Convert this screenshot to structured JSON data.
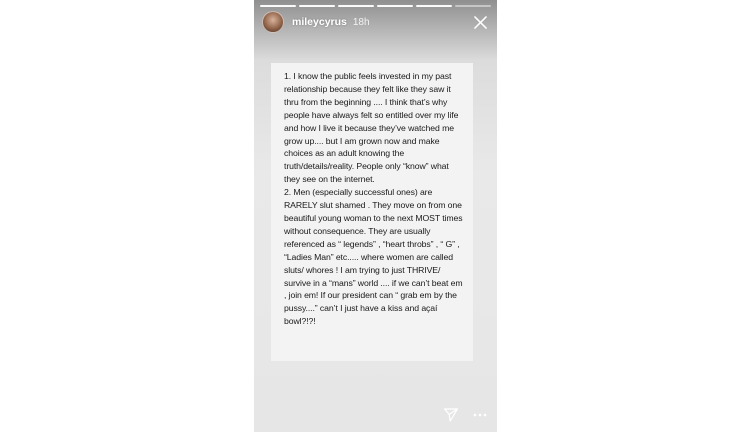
{
  "story": {
    "progress_segments": 6,
    "progress_done": 5,
    "user": {
      "username": "mileycyrus",
      "time": "18h"
    },
    "text": "1. I know the public feels invested in my past relationship because they felt like they saw it thru from the beginning .... I think that’s why people have always felt so entitled over my life and how I live it because they’ve watched me grow up.... but I am grown now and make choices as an adult knowing the truth/details/reality. People only “know” what they see on the internet.\n2. Men (especially successful ones) are RARELY slut shamed . They move on from one beautiful young woman to the next MOST times without consequence. They are usually referenced as “ legends” , “heart throbs” , “ G” , “Ladies Man” etc..... where women are called sluts/ whores ! I am trying to just THRIVE/ survive in a “mans” world .... if we can’t beat em , join em! If our president can “ grab em by the pussy....”  can’t I just have a kiss and açaí bowl?!?!",
    "icons": {
      "close": "close-icon",
      "send": "send-icon",
      "more": "more-options-icon"
    }
  }
}
